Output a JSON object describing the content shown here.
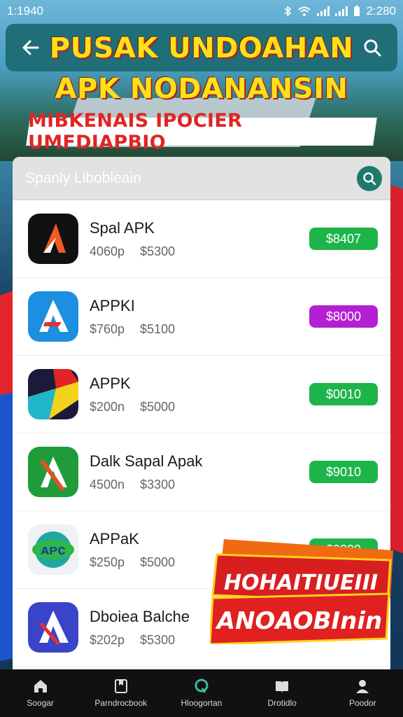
{
  "status_bar": {
    "time": "1:1940",
    "clock": "2:280"
  },
  "header": {
    "headline_line1": "PUSAK UNDOAHAN",
    "headline_line2": "APK NODANANSIN",
    "subheadline": "MIBKENAIS IPOCIER UMFDIAPBIO"
  },
  "search": {
    "placeholder": "Spanly Libobleain"
  },
  "apps": [
    {
      "name": "Spal APK",
      "size": "4060p",
      "price": "$5300",
      "button": "$8407",
      "button_color": "#1db54a"
    },
    {
      "name": "APPKI",
      "size": "$760p",
      "price": "$5100",
      "button": "$8000",
      "button_color": "#b51fd4"
    },
    {
      "name": "APPK",
      "size": "$200n",
      "price": "$5000",
      "button": "$0010",
      "button_color": "#1db54a"
    },
    {
      "name": "Dalk Sapal Apak",
      "size": "4500n",
      "price": "$3300",
      "button": "$9010",
      "button_color": "#1db54a"
    },
    {
      "name": "APPaK",
      "size": "$250p",
      "price": "$5000",
      "button": "$9200",
      "button_color": "#1db54a"
    },
    {
      "name": "Dboiea Balche",
      "size": "$202p",
      "price": "$5300",
      "button": "",
      "button_color": "#1db54a"
    }
  ],
  "promo": {
    "line1": "HOHAITIUEIII",
    "line2": "ANOAOBInin"
  },
  "nav": [
    {
      "label": "Soogar",
      "icon": "home-icon"
    },
    {
      "label": "Parndrocbook",
      "icon": "bookmark-icon"
    },
    {
      "label": "Hloogortan",
      "icon": "search-icon"
    },
    {
      "label": "Drotidlo",
      "icon": "library-icon"
    },
    {
      "label": "Poodor",
      "icon": "profile-icon"
    }
  ],
  "colors": {
    "accent": "#1f7a6e",
    "headline": "#ffe018",
    "banner_red": "#e22424"
  }
}
